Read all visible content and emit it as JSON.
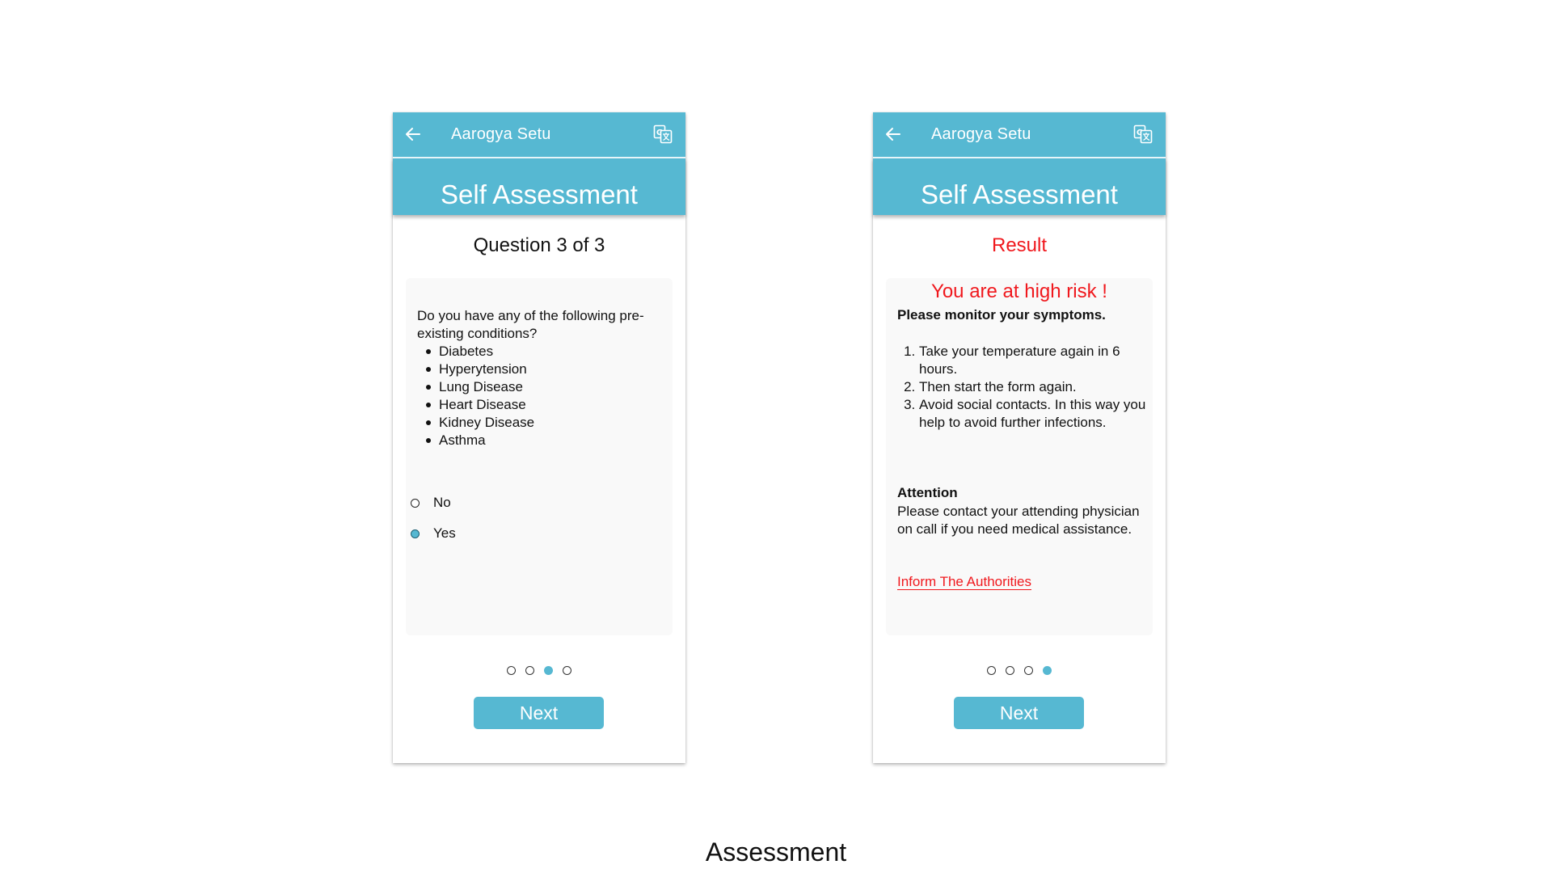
{
  "caption": "Assessment",
  "colors": {
    "accent": "#56b8d2",
    "danger": "#f0181d",
    "text": "#111111"
  },
  "question_screen": {
    "app_bar": {
      "title": "Aarogya Setu",
      "back_icon": "arrow-left-icon",
      "translate_icon": "translate-icon"
    },
    "header": "Self Assessment",
    "subtitle": "Question 3 of 3",
    "question": "Do you have any of the following pre-existing conditions?",
    "conditions": [
      "Diabetes",
      "Hyperytension",
      "Lung Disease",
      "Heart Disease",
      "Kidney Disease",
      "Asthma"
    ],
    "options": [
      {
        "label": "No",
        "selected": false
      },
      {
        "label": "Yes",
        "selected": true
      }
    ],
    "pager": {
      "total": 4,
      "active": 3
    },
    "next_label": "Next"
  },
  "result_screen": {
    "app_bar": {
      "title": "Aarogya Setu",
      "back_icon": "arrow-left-icon",
      "translate_icon": "translate-icon"
    },
    "header": "Self Assessment",
    "subtitle": "Result",
    "risk_heading": "You are at high risk !",
    "monitor": "Please monitor your symptoms.",
    "steps": [
      "Take your temperature again in 6 hours.",
      "Then start the form again.",
      "Avoid social contacts. In this way you help to avoid further infections."
    ],
    "attention_title": "Attention",
    "attention_text": "Please contact your attending physician on call if you need medical assistance.",
    "inform_link": "Inform The Authorities",
    "pager": {
      "total": 4,
      "active": 4
    },
    "next_label": "Next"
  }
}
